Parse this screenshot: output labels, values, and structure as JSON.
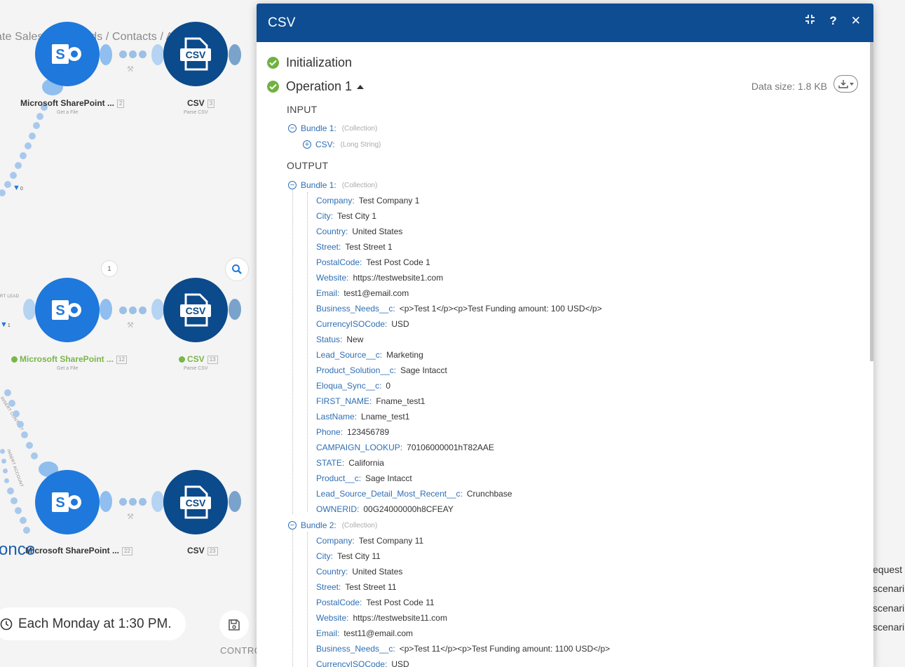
{
  "canvas": {
    "breadcrumb": "ate Salesforce Leads / Contacts / Accounts",
    "modules": [
      {
        "title": "Microsoft SharePoint ...",
        "num": "2",
        "sub": "Get a File"
      },
      {
        "title": "CSV",
        "num": "3",
        "sub": "Parse CSV"
      },
      {
        "title": "Microsoft SharePoint ...",
        "num": "12",
        "sub": "Get a File"
      },
      {
        "title": "CSV",
        "num": "13",
        "sub": "Parse CSV"
      },
      {
        "title": "Microsoft SharePoint ...",
        "num": "22",
        "sub": ""
      },
      {
        "title": "CSV",
        "num": "23",
        "sub": ""
      }
    ],
    "csv_icon_text": "CSV",
    "route_labels": [
      "INSERT CONTACT",
      "INSERT ACCOUNT",
      "RT LEAD"
    ],
    "bubble_count": "1",
    "filter_counts": [
      "0",
      "1"
    ],
    "once_fragment": "once",
    "schedule": "Each Monday at 1:30 PM.",
    "controls_label": "CONTRO",
    "right_fragments": [
      "equest",
      "scenari",
      "scenari",
      "scenari"
    ],
    "colors": {
      "sharepoint": "#1f78dc",
      "csv": "#0b4a8b",
      "success": "#7ab648"
    }
  },
  "panel": {
    "title": "CSV",
    "header_icons": [
      "collapse-icon",
      "help-icon",
      "close-icon"
    ],
    "sections": {
      "initialization": "Initialization",
      "operation": "Operation 1"
    },
    "data_size": "Data size: 1.8 KB",
    "input_label": "INPUT",
    "output_label": "OUTPUT",
    "input_bundle": {
      "label": "Bundle 1:",
      "type": "(Collection)"
    },
    "input_field": {
      "label": "CSV:",
      "type": "(Long String)"
    },
    "bundles": [
      {
        "label": "Bundle 1:",
        "type": "(Collection)",
        "fields": [
          {
            "k": "Company:",
            "v": "Test Company 1"
          },
          {
            "k": "City:",
            "v": "Test City 1"
          },
          {
            "k": "Country:",
            "v": "United States"
          },
          {
            "k": "Street:",
            "v": "Test Street 1"
          },
          {
            "k": "PostalCode:",
            "v": "Test Post Code 1"
          },
          {
            "k": "Website:",
            "v": "https://testwebsite1.com"
          },
          {
            "k": "Email:",
            "v": "test1@email.com"
          },
          {
            "k": "Business_Needs__c:",
            "v": "<p>Test 1</p><p>Test Funding amount: 100 USD</p>"
          },
          {
            "k": "CurrencyISOCode:",
            "v": "USD"
          },
          {
            "k": "Status:",
            "v": "New"
          },
          {
            "k": "Lead_Source__c:",
            "v": "Marketing"
          },
          {
            "k": "Product_Solution__c:",
            "v": "Sage Intacct"
          },
          {
            "k": "Eloqua_Sync__c:",
            "v": "0"
          },
          {
            "k": "FIRST_NAME:",
            "v": "Fname_test1"
          },
          {
            "k": "LastName:",
            "v": "Lname_test1"
          },
          {
            "k": "Phone:",
            "v": "123456789"
          },
          {
            "k": "CAMPAIGN_LOOKUP:",
            "v": "70106000001hT82AAE"
          },
          {
            "k": "STATE:",
            "v": "California"
          },
          {
            "k": "Product__c:",
            "v": "Sage Intacct"
          },
          {
            "k": "Lead_Source_Detail_Most_Recent__c:",
            "v": "Crunchbase"
          },
          {
            "k": "OWNERID:",
            "v": "00G24000000h8CFEAY"
          }
        ]
      },
      {
        "label": "Bundle 2:",
        "type": "(Collection)",
        "fields": [
          {
            "k": "Company:",
            "v": "Test Company 11"
          },
          {
            "k": "City:",
            "v": "Test City 11"
          },
          {
            "k": "Country:",
            "v": "United States"
          },
          {
            "k": "Street:",
            "v": "Test Street 11"
          },
          {
            "k": "PostalCode:",
            "v": "Test Post Code 11"
          },
          {
            "k": "Website:",
            "v": "https://testwebsite11.com"
          },
          {
            "k": "Email:",
            "v": "test11@email.com"
          },
          {
            "k": "Business_Needs__c:",
            "v": "<p>Test 11</p><p>Test Funding amount: 1100 USD</p>"
          },
          {
            "k": "CurrencyISOCode:",
            "v": "USD"
          }
        ]
      }
    ]
  }
}
